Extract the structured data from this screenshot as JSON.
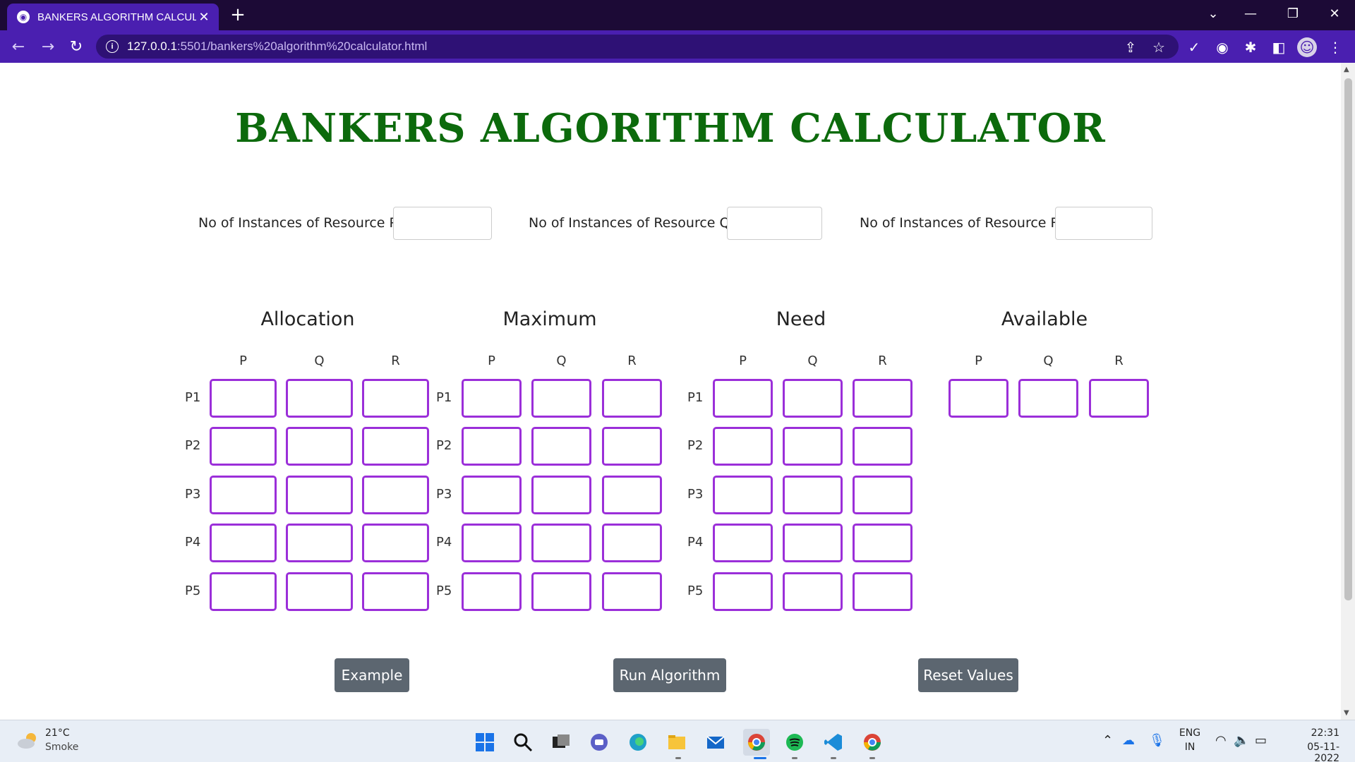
{
  "browser": {
    "tab_title": "BANKERS ALGORITHM CALCULA",
    "url_host": "127.0.0.1",
    "url_rest": ":5501/bankers%20algorithm%20calculator.html"
  },
  "page": {
    "title": "BANKERS ALGORITHM CALCULATOR",
    "resources": [
      {
        "label": "No of Instances of Resource P"
      },
      {
        "label": "No of Instances of Resource Q"
      },
      {
        "label": "No of Instances of Resource R"
      }
    ],
    "sections": {
      "allocation": "Allocation",
      "maximum": "Maximum",
      "need": "Need",
      "available": "Available"
    },
    "columns": [
      "P",
      "Q",
      "R"
    ],
    "processes": [
      "P1",
      "P2",
      "P3",
      "P4",
      "P5"
    ],
    "buttons": {
      "example": "Example",
      "run": "Run Algorithm",
      "reset": "Reset Values"
    }
  },
  "taskbar": {
    "temperature": "21°C",
    "condition": "Smoke",
    "language_line1": "ENG",
    "language_line2": "IN",
    "time": "22:31",
    "date": "05-11-2022"
  },
  "colors": {
    "title": "#0c6a0c",
    "cell_border": "#9b2fd9",
    "button_bg": "#5c6670",
    "chrome_bar": "#4a1fb0"
  }
}
